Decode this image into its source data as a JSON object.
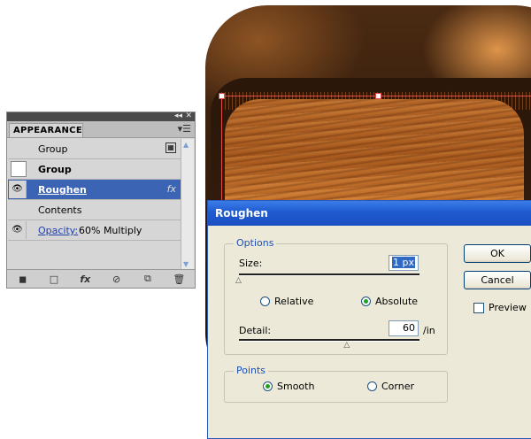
{
  "appearance_panel": {
    "tab_label": "APPEARANCE",
    "panel_controls": [
      "◂◂",
      "✕"
    ],
    "menu_icon": "panel-menu-icon",
    "rows": [
      {
        "label": "Group",
        "bold": false,
        "eye": false,
        "selected": false
      },
      {
        "label": "Group",
        "bold": true,
        "eye": false,
        "selected": false
      },
      {
        "label": "Roughen",
        "bold": true,
        "eye": true,
        "selected": true
      },
      {
        "label": "Contents",
        "bold": false,
        "eye": false,
        "selected": false
      },
      {
        "label": "Opacity:",
        "value": "60% Multiply",
        "eye": true,
        "selected": false
      }
    ],
    "footer_icons": [
      "clear-appearance-icon",
      "new-stroke-icon",
      "add-effect-icon",
      "reduce-icon",
      "duplicate-item-icon",
      "delete-icon"
    ]
  },
  "roughen_dialog": {
    "title": "Roughen",
    "options": {
      "legend": "Options",
      "size_label": "Size:",
      "size_value": "1 px",
      "size_fraction": 0.0,
      "relative_label": "Relative",
      "absolute_label": "Absolute",
      "absolute_selected": true,
      "detail_label": "Detail:",
      "detail_value": "60",
      "detail_unit": "/in",
      "detail_fraction": 0.6
    },
    "points": {
      "legend": "Points",
      "smooth_label": "Smooth",
      "corner_label": "Corner",
      "smooth_selected": true
    },
    "ok_label": "OK",
    "cancel_label": "Cancel",
    "preview_label": "Preview",
    "preview_checked": false
  },
  "colors": {
    "selection_blue": "#3c64b4",
    "title_blue": "#1f5bd0",
    "path_red": "#e04b4b",
    "radio_green": "#21a121"
  }
}
